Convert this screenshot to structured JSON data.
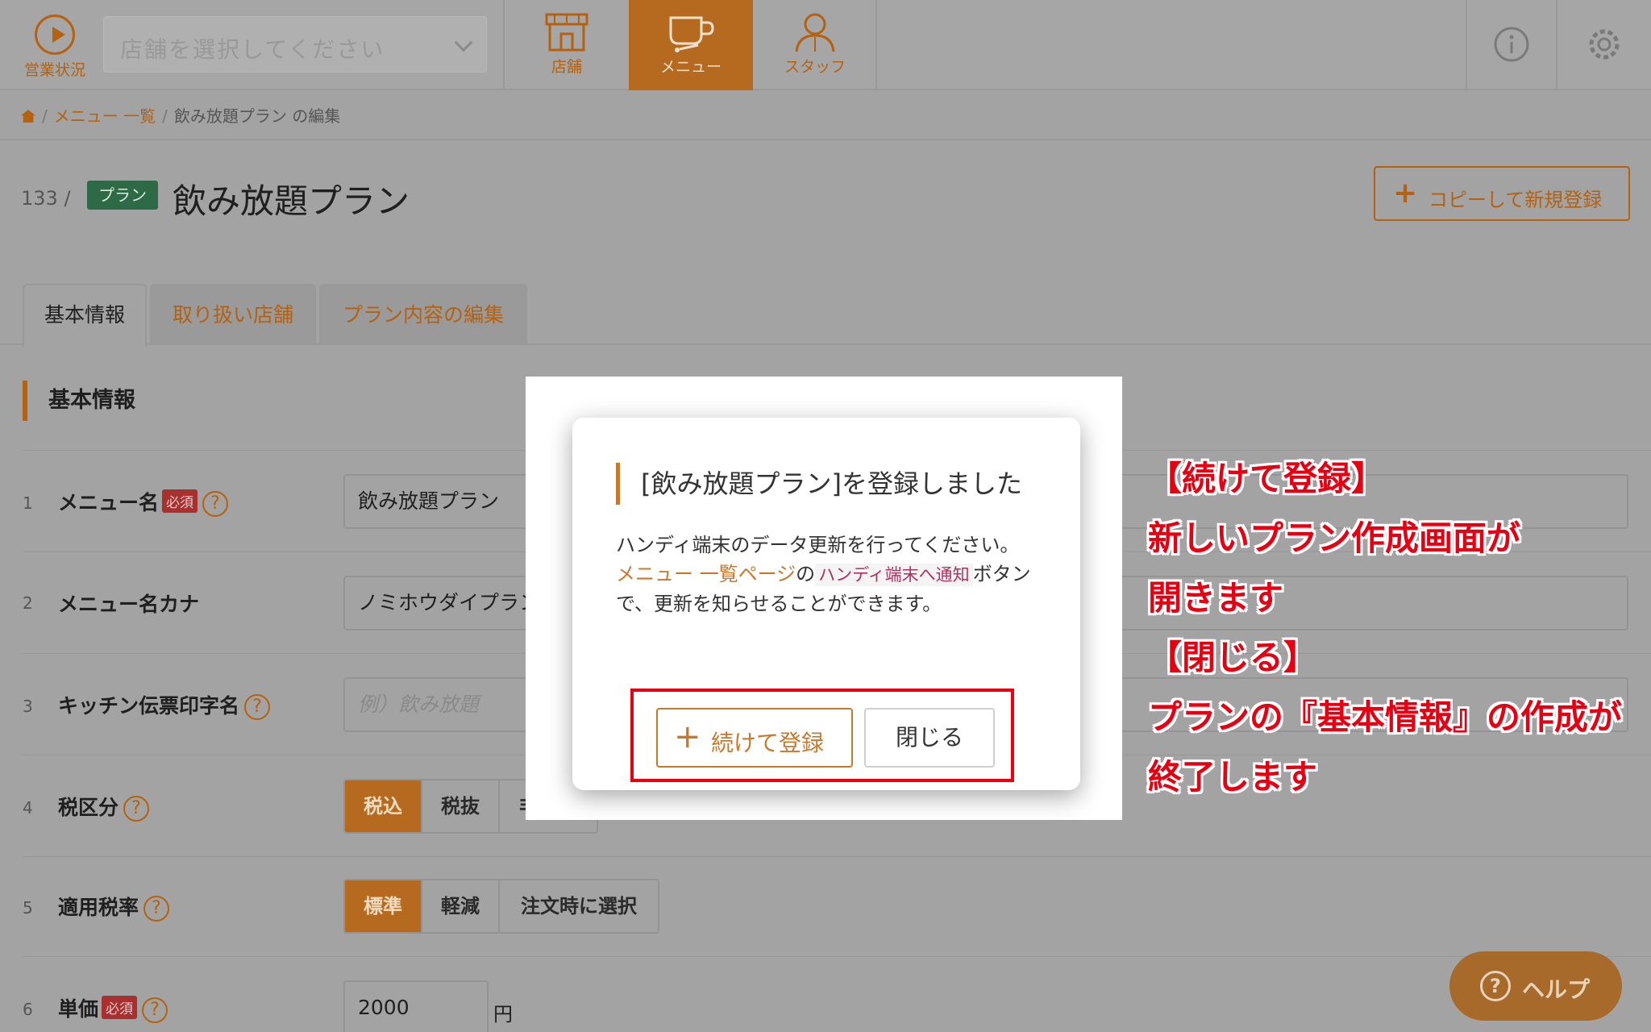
{
  "topbar": {
    "status_label": "営業状況",
    "store_placeholder": "店舗を選択してください",
    "nav": [
      {
        "label": "店舗",
        "icon": "store-icon"
      },
      {
        "label": "メニュー",
        "icon": "coffee-cup-icon"
      },
      {
        "label": "スタッフ",
        "icon": "staff-icon"
      }
    ],
    "active_nav": "メニュー"
  },
  "breadcrumb": {
    "link": "メニュー 一覧",
    "current": "飲み放題プラン の編集"
  },
  "page": {
    "id": "133 /",
    "badge": "プラン",
    "title": "飲み放題プラン",
    "copy_button": "コピーして新規登録"
  },
  "tabs": [
    "基本情報",
    "取り扱い店舗",
    "プラン内容の編集"
  ],
  "section_title": "基本情報",
  "form": {
    "rows": [
      {
        "num": "1",
        "label": "メニュー名",
        "required": "必須",
        "value": "飲み放題プラン"
      },
      {
        "num": "2",
        "label": "メニュー名カナ",
        "value": "ノミホウダイプラン"
      },
      {
        "num": "3",
        "label": "キッチン伝票印字名",
        "placeholder": "例）飲み放題"
      },
      {
        "num": "4",
        "label": "税区分",
        "options": [
          "税込",
          "税抜",
          "非課税"
        ],
        "selected": "税込"
      },
      {
        "num": "5",
        "label": "適用税率",
        "options": [
          "標準",
          "軽減",
          "注文時に選択"
        ],
        "selected": "標準"
      },
      {
        "num": "6",
        "label": "単価",
        "required": "必須",
        "value": "2000",
        "unit": "円"
      }
    ]
  },
  "help_button": "ヘルプ",
  "modal": {
    "title": "[飲み放題プラン]を登録しました",
    "body_line1": "ハンディ端末のデータ更新を行ってください。",
    "body_link": "メニュー 一覧ページ",
    "body_no": "の",
    "body_code": "ハンディ端末へ通知",
    "body_rest": "ボタンで、更新を知らせることができます。",
    "continue_button": "続けて登録",
    "close_button": "閉じる"
  },
  "annotation": {
    "lines": [
      "【続けて登録】",
      "新しいプラン作成画面が",
      "開きます",
      "【閉じる】",
      "プランの『基本情報』の作成が",
      "終了します"
    ]
  },
  "colors": {
    "accent": "#c8782b",
    "annotation_red": "#e60012",
    "badge_green": "#2f6a47",
    "overlay_gray": "#a3a3a3"
  }
}
